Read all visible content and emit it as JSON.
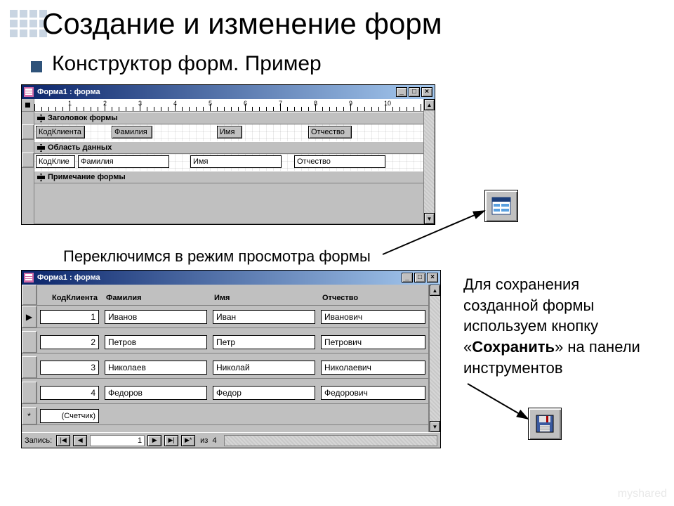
{
  "slide": {
    "title": "Создание и изменение форм",
    "subtitle": "Конструктор форм. Пример",
    "caption_mode": "Переключимся в режим просмотра формы",
    "caption_save_1": "Для сохранения созданной формы используем кнопку «",
    "caption_save_bold": "Сохранить",
    "caption_save_2": "» на панели инструментов",
    "watermark": "myshared"
  },
  "design_window": {
    "title": "Форма1 : форма",
    "sections": {
      "header_label": "Заголовок формы",
      "detail_label": "Область данных",
      "footer_label": "Примечание формы"
    },
    "header_labels": {
      "code": "КодКлиента",
      "fam": "Фамилия",
      "name": "Имя",
      "otch": "Отчество"
    },
    "detail_fields": {
      "code": "КодКлие",
      "fam": "Фамилия",
      "name": "Имя",
      "otch": "Отчество"
    },
    "ruler_marks": [
      "1",
      "2",
      "3",
      "4",
      "5",
      "6",
      "7",
      "8",
      "9",
      "10"
    ]
  },
  "data_window": {
    "title": "Форма1 : форма",
    "columns": [
      "КодКлиента",
      "Фамилия",
      "Имя",
      "Отчество"
    ],
    "rows": [
      {
        "code": "1",
        "fam": "Иванов",
        "name": "Иван",
        "otch": "Иванович"
      },
      {
        "code": "2",
        "fam": "Петров",
        "name": "Петр",
        "otch": "Петрович"
      },
      {
        "code": "3",
        "fam": "Николаев",
        "name": "Николай",
        "otch": "Николаевич"
      },
      {
        "code": "4",
        "fam": "Федоров",
        "name": "Федор",
        "otch": "Федорович"
      }
    ],
    "new_row_code": "(Счетчик)",
    "recnav": {
      "label": "Запись:",
      "current": "1",
      "total_prefix": "из",
      "total": "4"
    }
  },
  "icons": {
    "formview": "form-view-icon",
    "save": "save-icon"
  }
}
